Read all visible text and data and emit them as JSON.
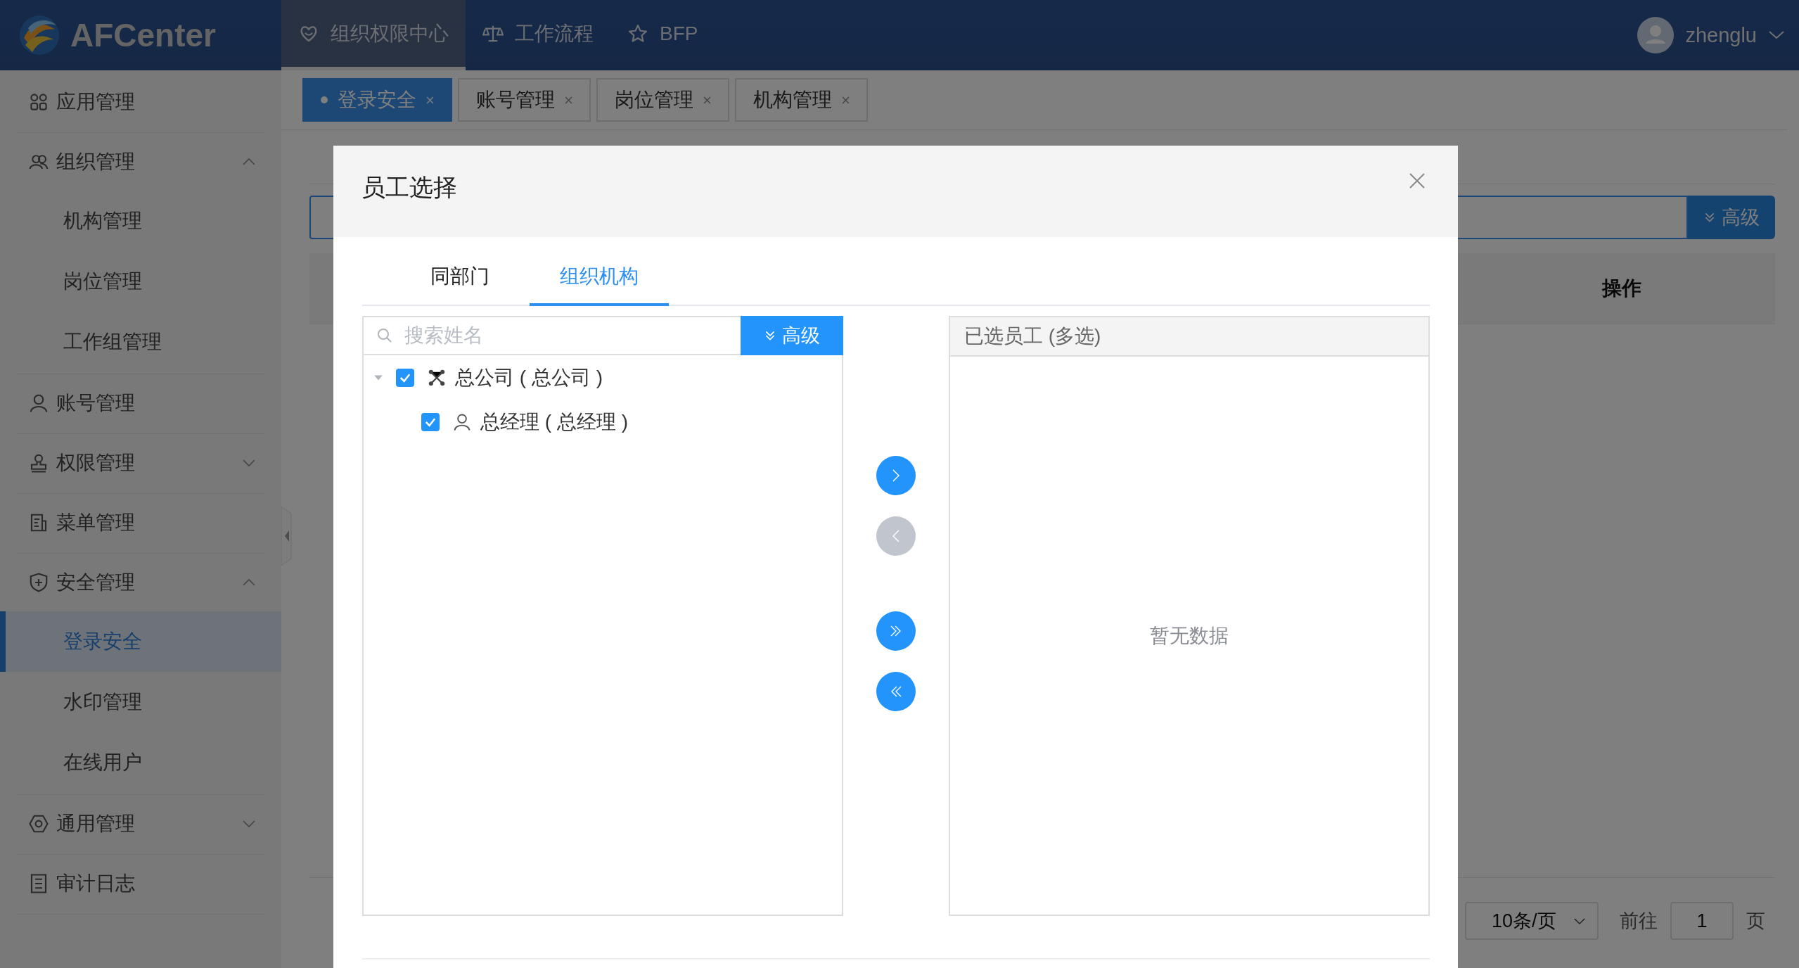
{
  "header": {
    "logo_text": "AFCenter",
    "nav": [
      {
        "label": "组织权限中心",
        "selected": true
      },
      {
        "label": "工作流程",
        "selected": false
      },
      {
        "label": "BFP",
        "selected": false
      }
    ],
    "user": {
      "name": "zhenglu"
    }
  },
  "sidebar": {
    "items": [
      {
        "label": "应用管理",
        "kind": "link",
        "selected": false
      },
      {
        "label": "组织管理",
        "kind": "group",
        "expanded": true,
        "children": [
          {
            "label": "机构管理",
            "selected": false
          },
          {
            "label": "岗位管理",
            "selected": false
          },
          {
            "label": "工作组管理",
            "selected": false
          }
        ]
      },
      {
        "label": "账号管理",
        "kind": "link",
        "selected": false
      },
      {
        "label": "权限管理",
        "kind": "group",
        "expanded": false
      },
      {
        "label": "菜单管理",
        "kind": "link",
        "selected": false
      },
      {
        "label": "安全管理",
        "kind": "group",
        "expanded": true,
        "children": [
          {
            "label": "登录安全",
            "selected": true
          },
          {
            "label": "水印管理",
            "selected": false
          },
          {
            "label": "在线用户",
            "selected": false
          }
        ]
      },
      {
        "label": "通用管理",
        "kind": "group",
        "expanded": false
      },
      {
        "label": "审计日志",
        "kind": "link",
        "selected": false
      }
    ]
  },
  "tabs": [
    {
      "label": "登录安全",
      "selected": true
    },
    {
      "label": "账号管理",
      "selected": false
    },
    {
      "label": "岗位管理",
      "selected": false
    },
    {
      "label": "机构管理",
      "selected": false
    }
  ],
  "content": {
    "advanced_button": "高级",
    "columns": [
      "操作"
    ],
    "pagination": {
      "page_size": "10条/页",
      "goto_label": "前往",
      "page": "1",
      "page_suffix": "页"
    }
  },
  "dialog": {
    "title": "员工选择",
    "tabs": [
      {
        "label": "同部门",
        "selected": false
      },
      {
        "label": "组织机构",
        "selected": true
      }
    ],
    "search": {
      "placeholder": "搜索姓名"
    },
    "advanced_button": "高级",
    "tree": [
      {
        "label": "总公司 ( 总公司 )",
        "kind": "org",
        "checked": true,
        "expanded": true,
        "children": [
          {
            "label": "总经理 ( 总经理 )",
            "kind": "person",
            "checked": true
          }
        ]
      }
    ],
    "transfer_buttons": [
      {
        "kind": "right",
        "disabled": false
      },
      {
        "kind": "left",
        "disabled": true
      },
      {
        "kind": "all-right",
        "disabled": false
      },
      {
        "kind": "all-left",
        "disabled": false
      }
    ],
    "selected_panel": {
      "title": "已选员工 (多选)",
      "empty_text": "暂无数据"
    }
  }
}
